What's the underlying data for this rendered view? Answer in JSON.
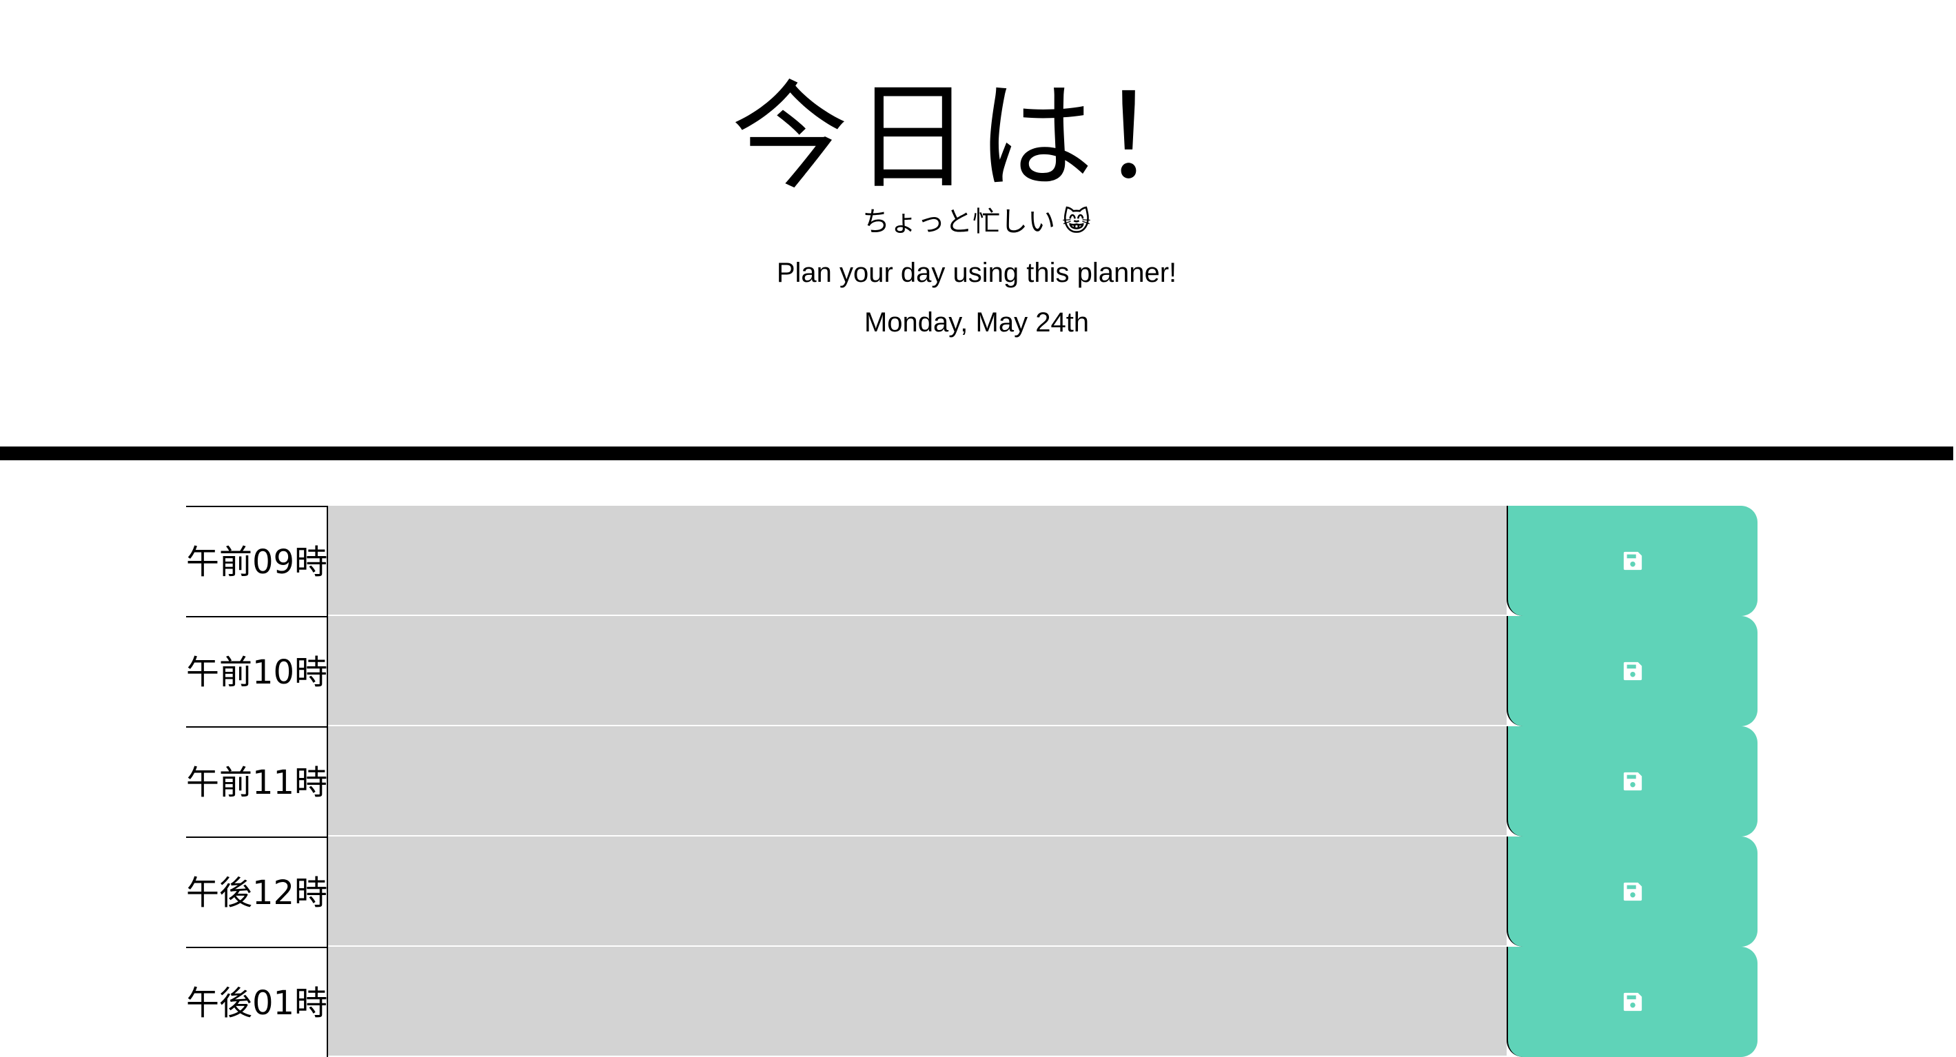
{
  "header": {
    "title": "今日は！",
    "subtitle": "ちょっと忙しい",
    "subtitle_emoji": "😸",
    "lead": "Plan your day using this planner!",
    "date": "Monday, May 24th"
  },
  "colors": {
    "save_button": "#5fd3b8",
    "time_block": "#d3d3d3",
    "divider": "#000000"
  },
  "planner": {
    "rows": [
      {
        "hour": "午前09時",
        "text": "",
        "icon": "floppy-disk-icon"
      },
      {
        "hour": "午前10時",
        "text": "",
        "icon": "floppy-disk-icon"
      },
      {
        "hour": "午前11時",
        "text": "",
        "icon": "floppy-disk-icon"
      },
      {
        "hour": "午後12時",
        "text": "",
        "icon": "floppy-disk-icon"
      },
      {
        "hour": "午後01時",
        "text": "",
        "icon": "floppy-disk-icon"
      }
    ]
  }
}
